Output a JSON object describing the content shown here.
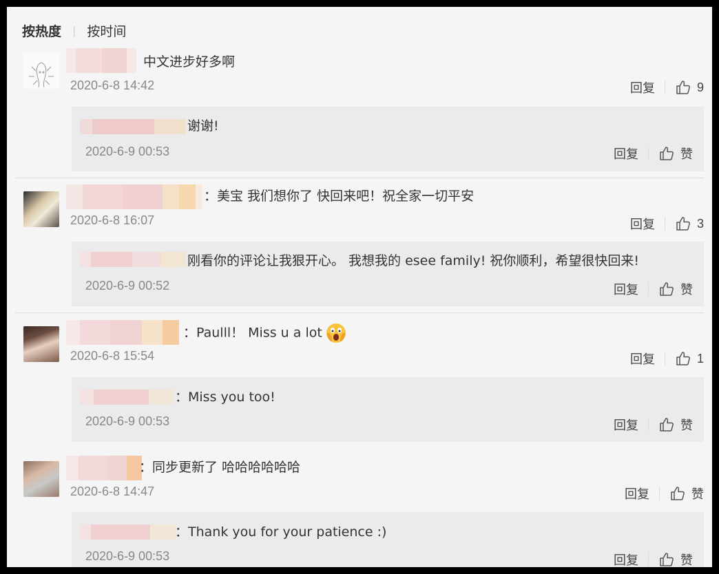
{
  "sort": {
    "active": "按热度",
    "inactive": "按时间"
  },
  "labels": {
    "reply": "回复",
    "like_placeholder": "赞"
  },
  "comments": [
    {
      "text": "中文进步好多啊",
      "time": "2020-6-8 14:42",
      "likes": "9",
      "reply": {
        "text": "谢谢!",
        "time": "2020-6-9 00:53",
        "likes": "赞"
      }
    },
    {
      "text": "：美宝 我们想你了 快回来吧！祝全家一切平安",
      "time": "2020-6-8 16:07",
      "likes": "3",
      "reply": {
        "text": "刚看你的评论让我狠开心。 我想我的 esee family! 祝你顺利，希望很快回来!",
        "time": "2020-6-9 00:52",
        "likes": "赞"
      }
    },
    {
      "text": "：Paulll！ Miss u a lot",
      "time": "2020-6-8 15:54",
      "likes": "1",
      "reply": {
        "text": "：Miss you too!",
        "time": "2020-6-9 00:53",
        "likes": "赞"
      }
    },
    {
      "text": "：同步更新了 哈哈哈哈哈哈",
      "time": "2020-6-8 14:47",
      "likes": "赞",
      "reply": {
        "text": "：Thank you for your patience :)",
        "time": "2020-6-9 00:53",
        "likes": "赞"
      }
    }
  ],
  "icons": {
    "like": "thumbs-up-icon",
    "emoji": "scared-face-emoji"
  },
  "colors": {
    "background": "#f5f5f5",
    "reply_box": "#ebebeb",
    "muted_text": "#888888",
    "frame": "#000000"
  }
}
